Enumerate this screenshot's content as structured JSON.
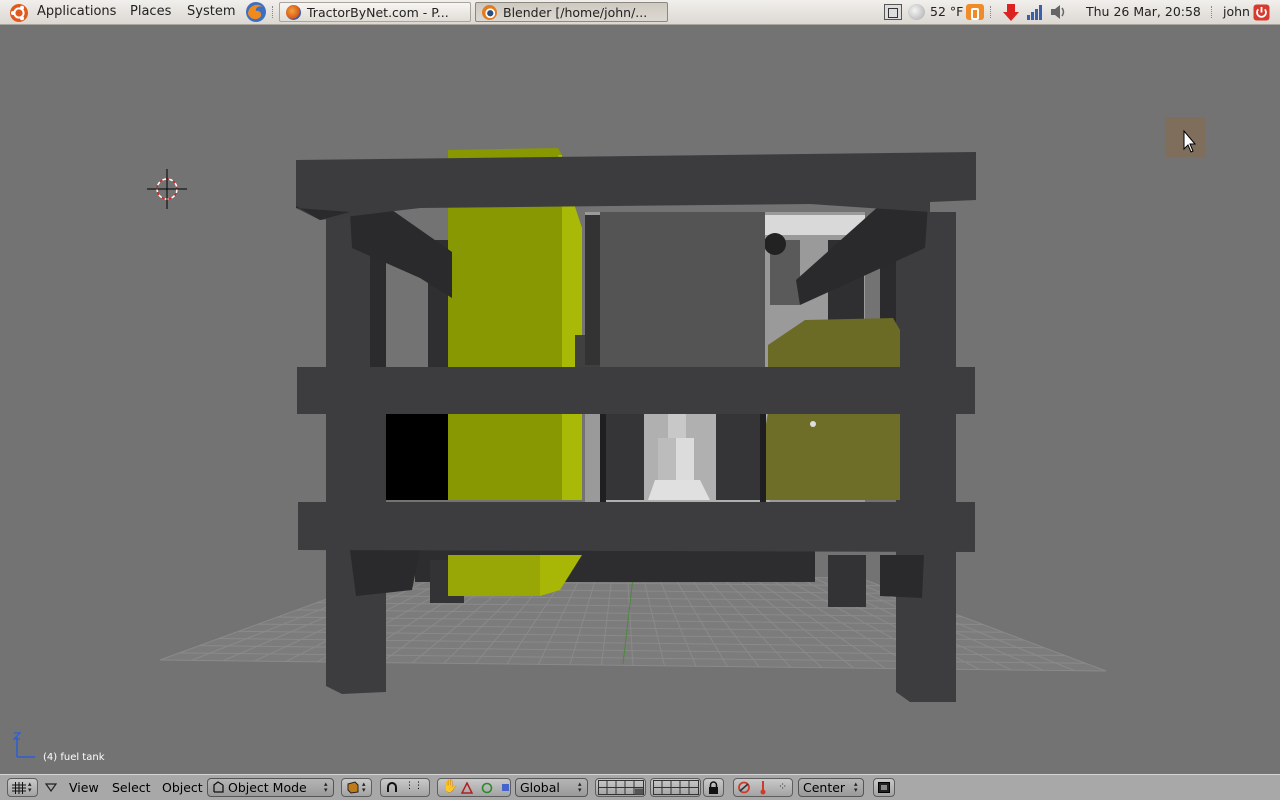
{
  "panel": {
    "menus": [
      "Applications",
      "Places",
      "System"
    ],
    "tasks": [
      {
        "label": "TractorByNet.com - P...",
        "active": false
      },
      {
        "label": "Blender [/home/john/...",
        "active": true
      }
    ],
    "temperature": "52 °F",
    "datetime": "Thu 26 Mar, 20:58",
    "user": "john"
  },
  "viewport": {
    "object_label": "(4) fuel tank"
  },
  "header": {
    "menus": [
      "View",
      "Select",
      "Object"
    ],
    "mode": "Object Mode",
    "orientation": "Global",
    "pivot": "Center"
  },
  "colors": {
    "panel_bg": "#e6e3de",
    "viewport_bg": "#737373",
    "frame": "#3b3b3e",
    "tank_yellow": "#8a9a04",
    "battery_olive": "#6b6a25",
    "header_bg": "#a8a8a8"
  }
}
